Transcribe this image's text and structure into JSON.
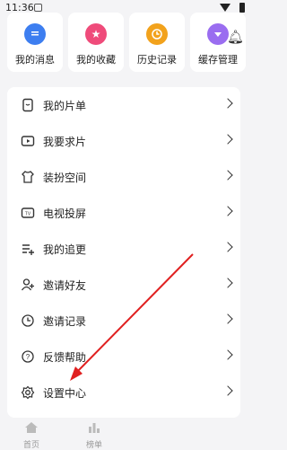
{
  "status": {
    "time": "11:36"
  },
  "quick_actions": [
    {
      "label": "我的消息",
      "icon": "message-icon",
      "color": "#3d7ef0"
    },
    {
      "label": "我的收藏",
      "icon": "star-icon",
      "color": "#ef4b7a"
    },
    {
      "label": "历史记录",
      "icon": "clock-icon",
      "color": "#f2a21c"
    },
    {
      "label": "缓存管理",
      "icon": "download-icon",
      "color": "#9a6df0"
    }
  ],
  "menu": [
    {
      "label": "我的片单",
      "icon": "playlist-icon"
    },
    {
      "label": "我要求片",
      "icon": "request-video-icon"
    },
    {
      "label": "装扮空间",
      "icon": "shirt-icon"
    },
    {
      "label": "电视投屏",
      "icon": "tv-icon"
    },
    {
      "label": "我的追更",
      "icon": "list-add-icon"
    },
    {
      "label": "邀请好友",
      "icon": "invite-user-icon"
    },
    {
      "label": "邀请记录",
      "icon": "history-icon"
    },
    {
      "label": "反馈帮助",
      "icon": "help-icon"
    },
    {
      "label": "设置中心",
      "icon": "settings-icon"
    }
  ],
  "tabs": [
    {
      "label": "首页",
      "icon": "home-icon"
    },
    {
      "label": "榜单",
      "icon": "chart-icon"
    }
  ],
  "annotation": {
    "color": "#e02020"
  }
}
